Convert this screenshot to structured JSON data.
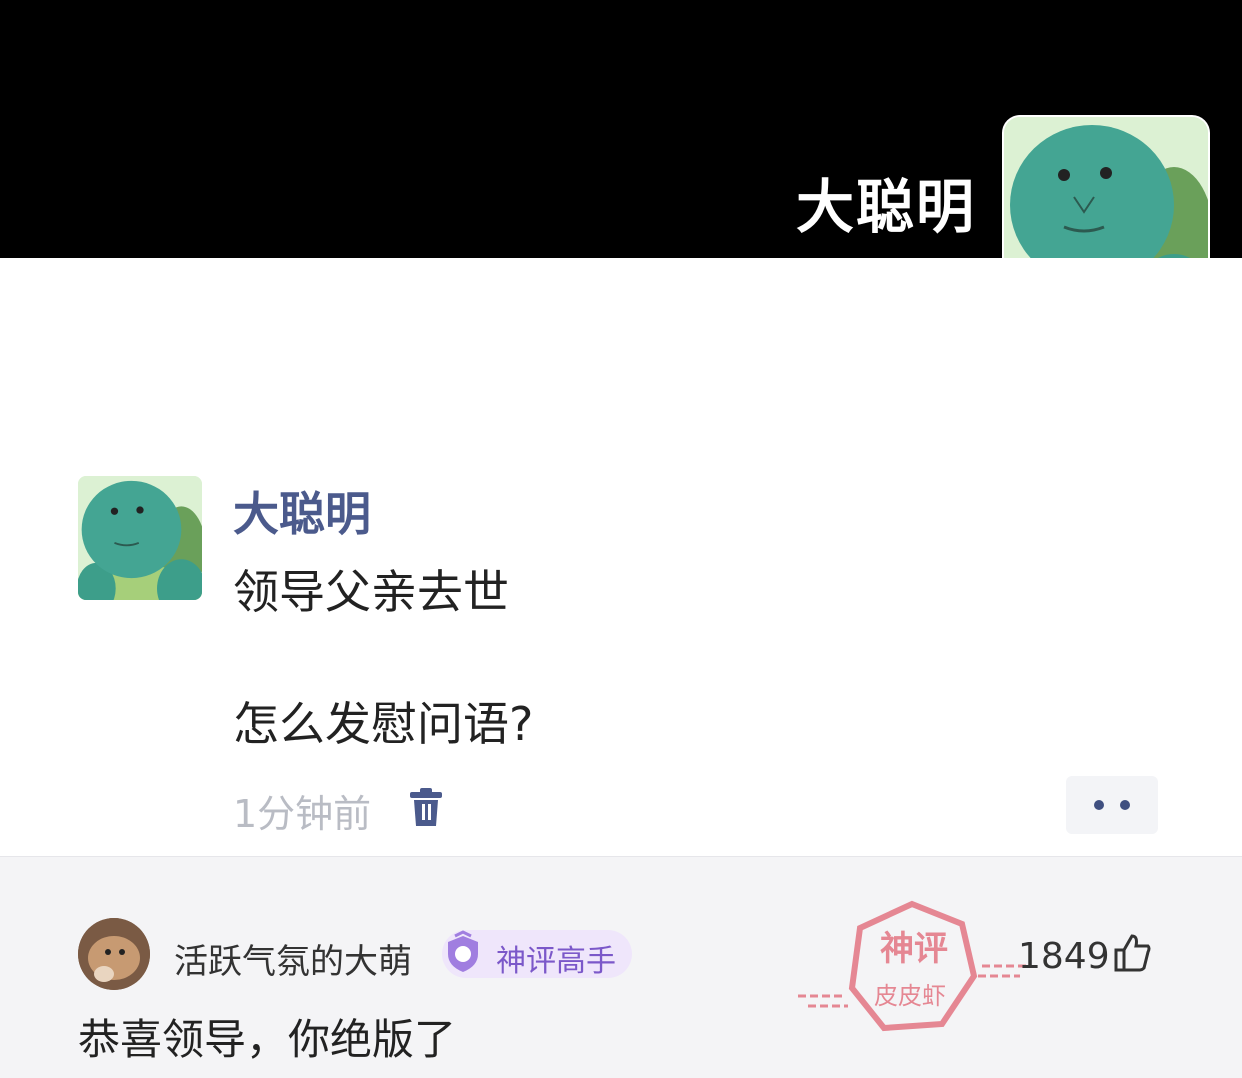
{
  "header": {
    "name": "大聪明",
    "avatar_icon": "turtle-avatar-icon"
  },
  "post": {
    "author": "大聪明",
    "lines": [
      "领导父亲去世",
      "怎么发慰问语?"
    ],
    "time": "1分钟前",
    "delete_icon": "trash-icon",
    "more_icon": "more-dots-icon"
  },
  "comment": {
    "username": "活跃气氛的大萌",
    "badge": "神评高手",
    "stamp": {
      "top": "神评",
      "bottom": "皮皮虾"
    },
    "likes": "1849",
    "text": "恭喜领导，你绝版了"
  },
  "colors": {
    "author": "#4b5a8c",
    "badge": "#7b58c9",
    "stamp": "#e05a6a"
  }
}
